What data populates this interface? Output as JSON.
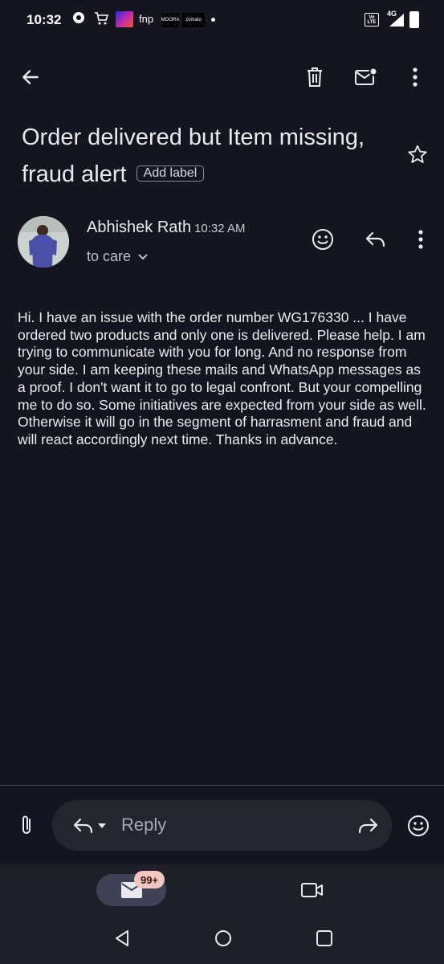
{
  "status_bar": {
    "time": "10:32",
    "fnp": "fnp",
    "moora": "MOORA",
    "zomato": "zomato",
    "volte": "Vo LTE",
    "network": "4G"
  },
  "app_bar": {
    "icons": [
      "back-arrow-icon",
      "delete-icon",
      "mark-unread-icon",
      "more-vert-icon"
    ]
  },
  "subject": {
    "text": "Order delivered but Item missing, fraud alert",
    "label_chip": "Add label",
    "starred": false
  },
  "message": {
    "sender": "Abhishek Rath",
    "time": "10:32 AM",
    "to": "to care",
    "body": "Hi. I have an issue with the order number WG176330 ... I have ordered two products and only one is delivered. Please help. I am trying to communicate with you for long. And no response from your side. I am keeping these mails and WhatsApp messages as a proof. I don't want it to go to legal confront. But your compelling me to do so. Some initiatives are expected from your side as well. Otherwise it will go in the segment of harrasment and fraud and will react accordingly next time. Thanks in advance."
  },
  "reply_bar": {
    "placeholder": "Reply"
  },
  "bottom_nav": {
    "mail_badge": "99+"
  },
  "colors": {
    "background": "#141520",
    "pill": "#23252f",
    "nav": "#1e1f29",
    "badge": "#f2c6c2"
  }
}
